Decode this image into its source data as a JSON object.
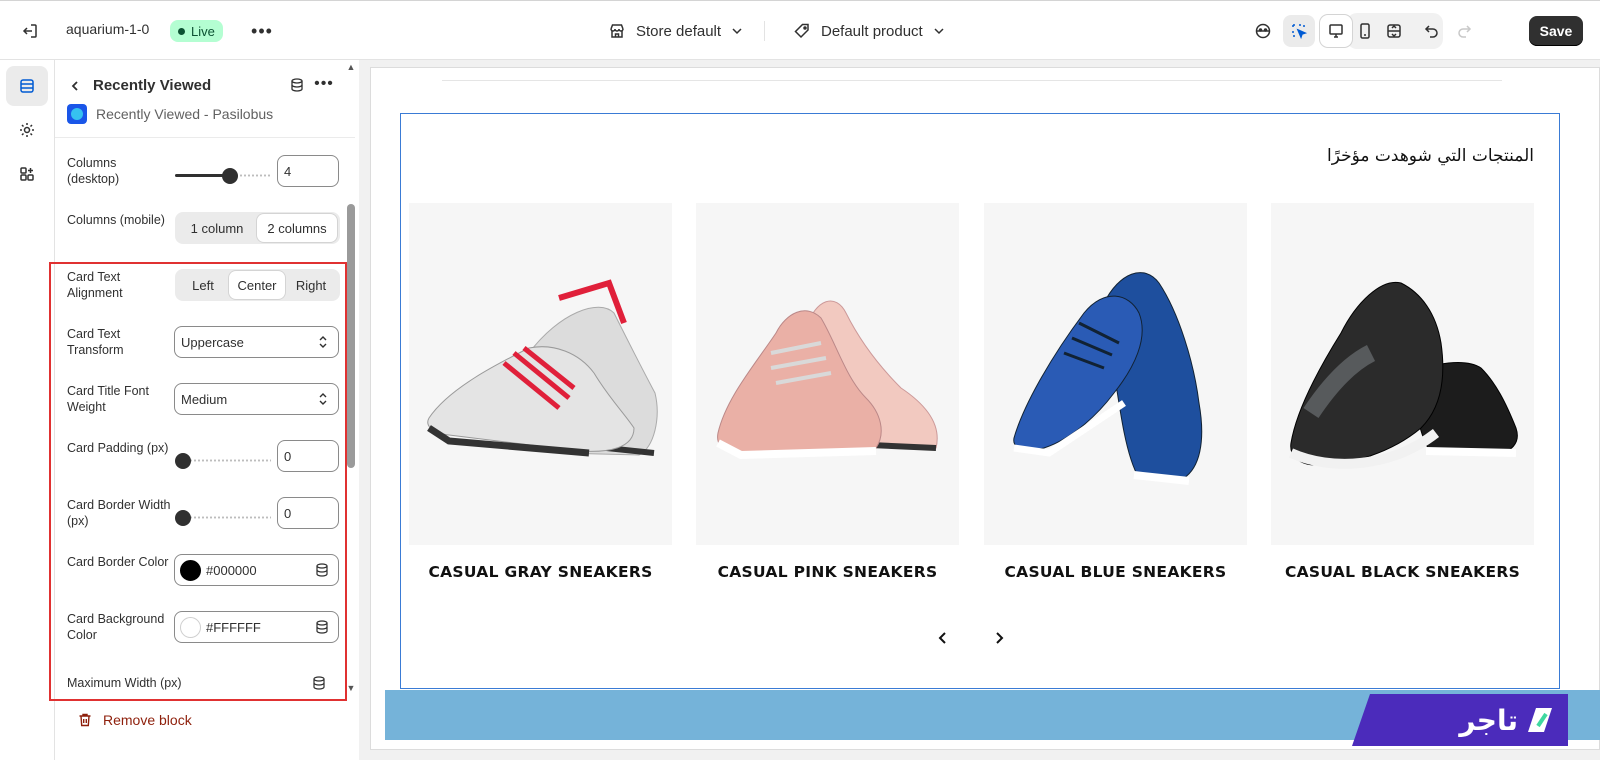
{
  "topbar": {
    "store_name": "aquarium-1-0",
    "status_badge": "Live",
    "store_selector": "Store default",
    "template_selector": "Default product",
    "save_label": "Save"
  },
  "panel": {
    "title": "Recently Viewed",
    "subtitle": "Recently Viewed - Pasilobus",
    "settings": {
      "columns_desktop": {
        "label": "Columns (desktop)",
        "value": "4",
        "slider_fraction": 0.6
      },
      "columns_mobile": {
        "label": "Columns (mobile)",
        "options": [
          "1 column",
          "2 columns"
        ],
        "selected": "2 columns"
      },
      "card_text_alignment": {
        "label": "Card Text Alignment",
        "options": [
          "Left",
          "Center",
          "Right"
        ],
        "selected": "Center"
      },
      "card_text_transform": {
        "label": "Card Text Transform",
        "value": "Uppercase"
      },
      "card_title_font_weight": {
        "label": "Card Title Font Weight",
        "value": "Medium"
      },
      "card_padding": {
        "label": "Card Padding (px)",
        "value": "0",
        "slider_fraction": 0
      },
      "card_border_width": {
        "label": "Card Border Width (px)",
        "value": "0",
        "slider_fraction": 0
      },
      "card_border_color": {
        "label": "Card Border Color",
        "value": "#000000",
        "swatch": "#000000"
      },
      "card_background_color": {
        "label": "Card Background Color",
        "value": "#FFFFFF",
        "swatch": "#FFFFFF"
      },
      "maximum_width": {
        "label": "Maximum Width (px)"
      }
    },
    "remove_block_label": "Remove block"
  },
  "preview": {
    "section_title": "المنتجات التي شوهدت مؤخرًا",
    "products": [
      {
        "title": "CASUAL GRAY SNEAKERS",
        "color": "gray"
      },
      {
        "title": "CASUAL PINK SNEAKERS",
        "color": "pink"
      },
      {
        "title": "CASUAL BLUE SNEAKERS",
        "color": "blue"
      },
      {
        "title": "CASUAL BLACK SNEAKERS",
        "color": "black"
      }
    ],
    "logo_text": "تاجر"
  },
  "colors": {
    "accent": "#005bd3",
    "live_badge_bg": "#b4fed2",
    "highlight": "#e03131",
    "section_outline": "#3a7bd5",
    "footer_strip": "#75b3d9",
    "logo_bg": "#4b2bbb"
  }
}
